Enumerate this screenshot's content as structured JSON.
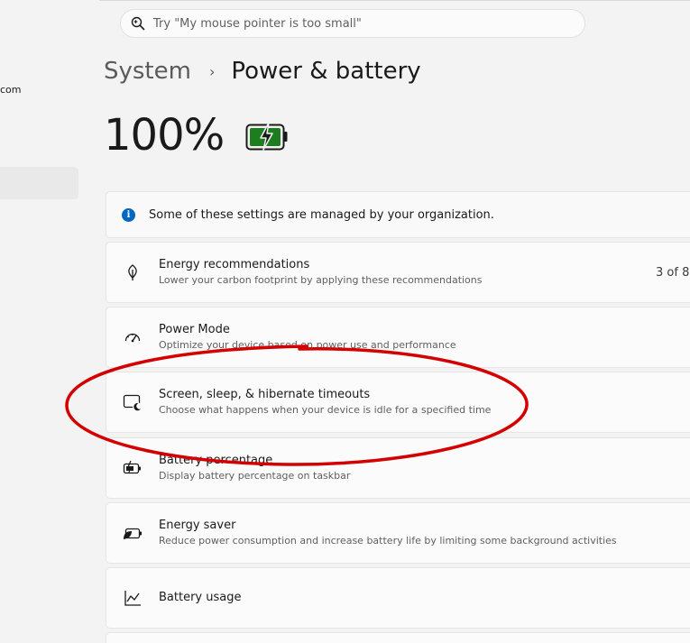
{
  "sidebar": {
    "account_email_fragment": "com"
  },
  "search": {
    "placeholder": "Try \"My mouse pointer is too small\""
  },
  "breadcrumb": {
    "parent": "System",
    "separator": "›",
    "current": "Power & battery"
  },
  "battery": {
    "level_text": "100%",
    "level_percent": 100,
    "icon": "battery-charging-icon",
    "fill_color": "#1e7d1e"
  },
  "info_banner": {
    "icon": "info-icon",
    "text": "Some of these settings are managed by your organization."
  },
  "settings": [
    {
      "key": "energy-recommendations",
      "icon": "leaf-icon",
      "title": "Energy recommendations",
      "subtitle": "Lower your carbon footprint by applying these recommendations",
      "value": "3 of 8"
    },
    {
      "key": "power-mode",
      "icon": "speedometer-icon",
      "title": "Power Mode",
      "subtitle": "Optimize your device based on power use and performance"
    },
    {
      "key": "screen-sleep-hibernate",
      "icon": "screen-sleep-icon",
      "title": "Screen, sleep, & hibernate timeouts",
      "subtitle": "Choose what happens when your device is idle for a specified time"
    },
    {
      "key": "battery-percentage",
      "icon": "battery-percent-icon",
      "title": "Battery percentage",
      "subtitle": "Display battery percentage on taskbar"
    },
    {
      "key": "energy-saver",
      "icon": "energy-saver-icon",
      "title": "Energy saver",
      "subtitle": "Reduce power consumption and increase battery life by limiting some background activities"
    },
    {
      "key": "battery-usage",
      "icon": "chart-line-icon",
      "title": "Battery usage"
    }
  ],
  "colors": {
    "accent": "#0067c0",
    "annotation": "#d40000"
  }
}
